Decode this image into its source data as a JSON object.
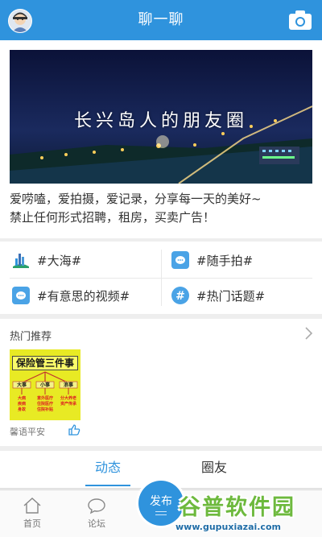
{
  "header": {
    "title": "聊一聊"
  },
  "banner": {
    "image_text": "长兴岛人的朋友圈",
    "desc_line1": "爱唠嗑，爱拍摄，爱记录，分享每一天的美好~",
    "desc_line2": "禁止任何形式招聘，租房，买卖广告！"
  },
  "topics": [
    {
      "label": "#大海#",
      "icon": "sea-building-icon"
    },
    {
      "label": "#随手拍#",
      "icon": "chat-bubble-icon"
    },
    {
      "label": "#有意思的视频#",
      "icon": "chat-bubble-icon"
    },
    {
      "label": "#热门话题#",
      "icon": "hashtag-icon"
    }
  ],
  "hot": {
    "title": "热门推荐",
    "card_title": "保险管三件事",
    "card_cols": [
      "大事",
      "小事",
      "浪事"
    ],
    "card_sub_cols": [
      "大病\n疾病\n身故",
      "意外医疗\n住院医疗\n住院补贴",
      "分大养老\n资产传承"
    ],
    "card_caption": "馨语平安"
  },
  "tabs": {
    "items": [
      "动态",
      "圈友"
    ],
    "active": "动态"
  },
  "bottomnav": {
    "home": "首页",
    "forum": "论坛",
    "publish": "发布"
  },
  "watermark": {
    "title": "谷普软件园",
    "url": "www.gupuxiazai.com"
  },
  "colors": {
    "accent": "#2f93dd",
    "watermark_green": "#6db93d"
  }
}
